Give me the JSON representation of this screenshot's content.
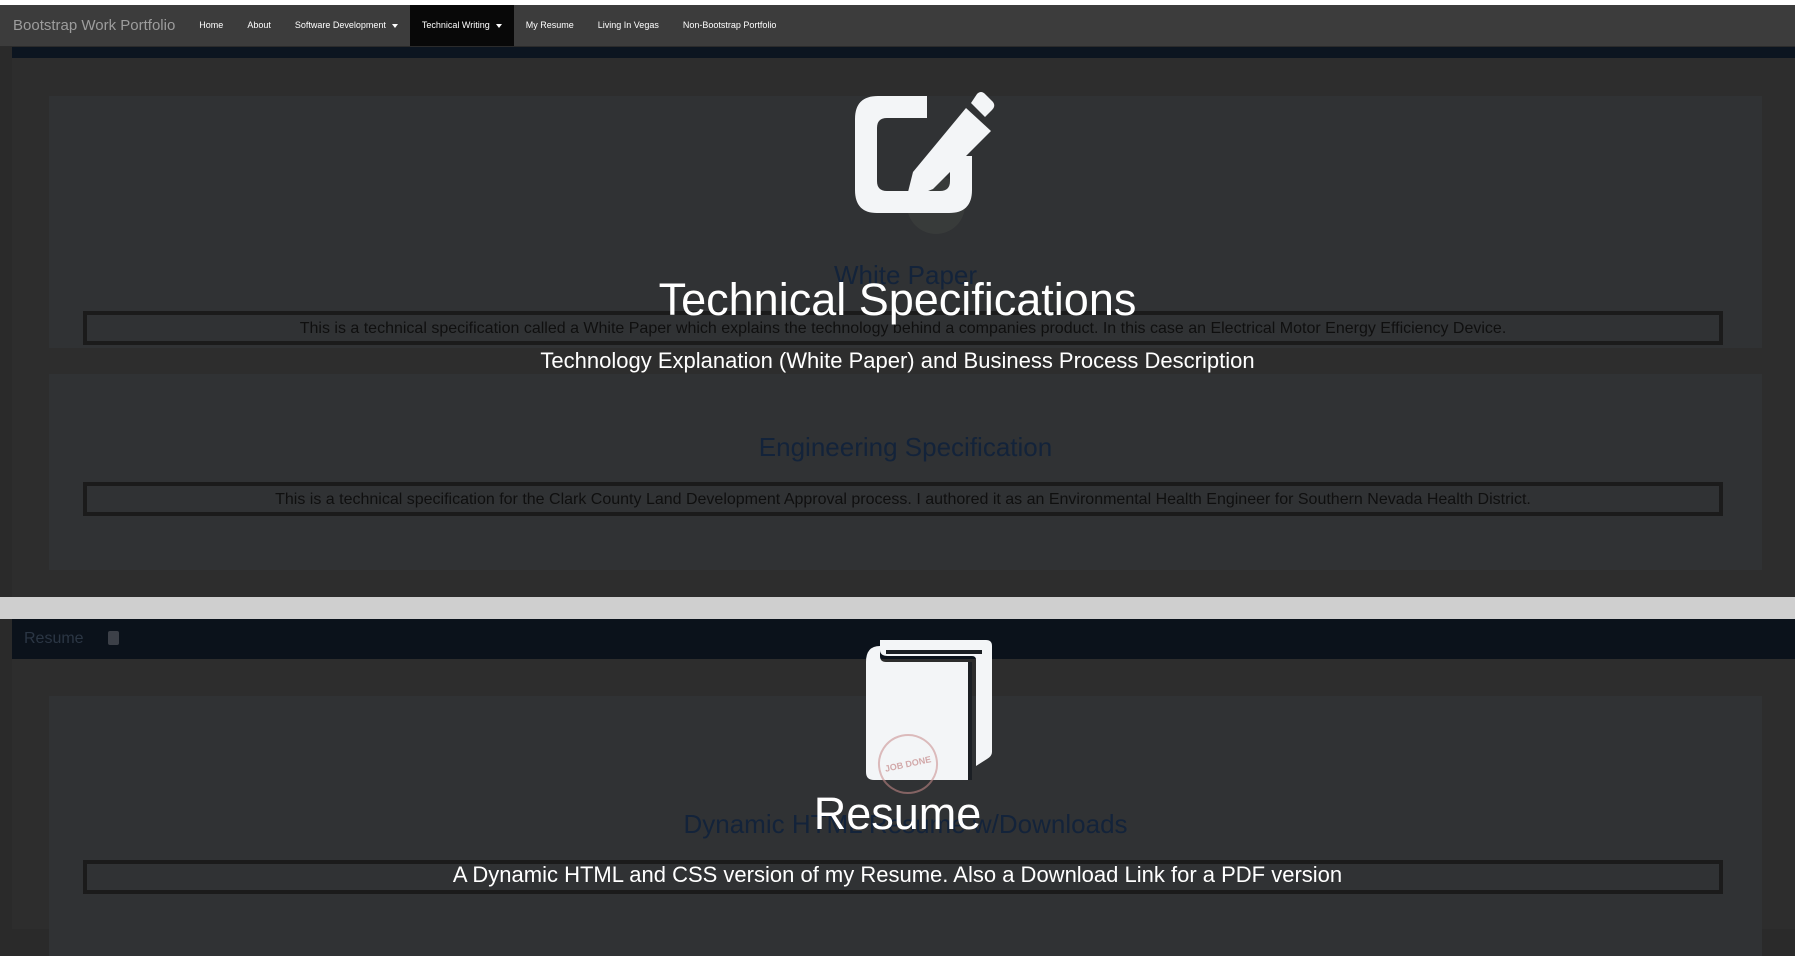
{
  "navbar": {
    "brand": "Bootstrap Work Portfolio",
    "items": [
      {
        "label": "Home",
        "active": false,
        "dropdown": false
      },
      {
        "label": "About",
        "active": false,
        "dropdown": false
      },
      {
        "label": "Software Development",
        "active": false,
        "dropdown": true
      },
      {
        "label": "Technical Writing",
        "active": true,
        "dropdown": true
      },
      {
        "label": "My Resume",
        "active": false,
        "dropdown": false
      },
      {
        "label": "Living In Vegas",
        "active": false,
        "dropdown": false
      },
      {
        "label": "Non-Bootstrap Portfolio",
        "active": false,
        "dropdown": false
      }
    ]
  },
  "technical_section": {
    "overlay_icon": "edit-square-pencil-icon",
    "overlay_title": "Technical Specifications",
    "overlay_subtitle": "Technology Explanation (White Paper) and Business Process Description",
    "cards": [
      {
        "title": "White Paper",
        "description": "This is a technical specification called a White Paper which explains the technology behind a companies product. In this case an Electrical Motor Energy Efficiency Device."
      },
      {
        "title": "Engineering Specification",
        "description": "This is a technical specification for the Clark County Land Development Approval process. I authored it as an Environmental Health Engineer for Southern Nevada Health District."
      }
    ]
  },
  "resume_section": {
    "header_label": "Resume",
    "header_icon": "book-icon",
    "overlay_icon": "book-icon",
    "stamp_text": "JOB DONE",
    "card_title": "Dynamic HTML Resume w/Downloads",
    "overlay_title": "Resume",
    "overlay_subtitle": "A Dynamic HTML and CSS version of my Resume. Also a Download Link for a PDF version"
  },
  "colors": {
    "navbar_bg": "#3c3c3c",
    "active_nav_bg": "#080808",
    "page_bg": "#2a2a2a",
    "overlay_text": "#ffffff",
    "card_title_text": "#13233a"
  }
}
